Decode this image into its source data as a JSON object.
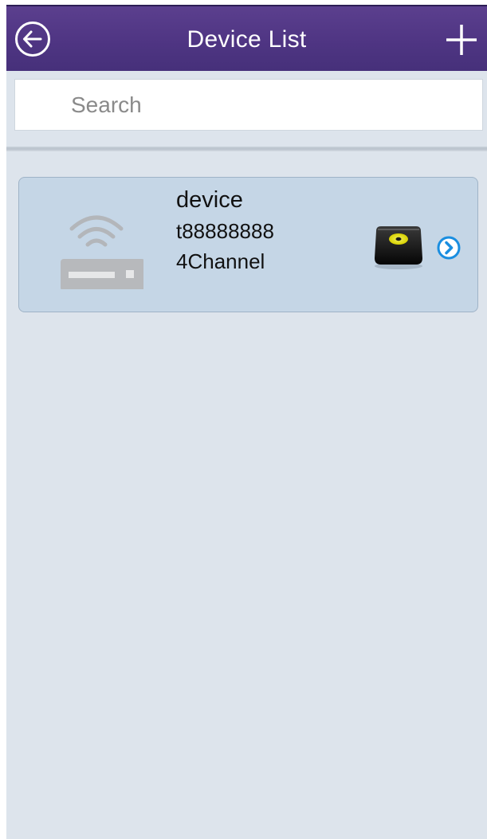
{
  "header": {
    "title": "Device List",
    "back_icon": "arrow-left-circle-icon",
    "add_icon": "plus-icon",
    "background": "#4f3583"
  },
  "search": {
    "placeholder": "Search",
    "value": ""
  },
  "devices": [
    {
      "name": "device",
      "id": "t88888888",
      "channels": "4Channel",
      "type_icon": "wifi-router-icon",
      "storage_icon": "hard-disk-icon",
      "open_icon": "chevron-right-circle-icon"
    }
  ],
  "colors": {
    "card_background": "#c5d6e6",
    "page_background": "#dde4ec",
    "accent_blue": "#1a8ee0",
    "disk_yellow": "#e6e000"
  }
}
